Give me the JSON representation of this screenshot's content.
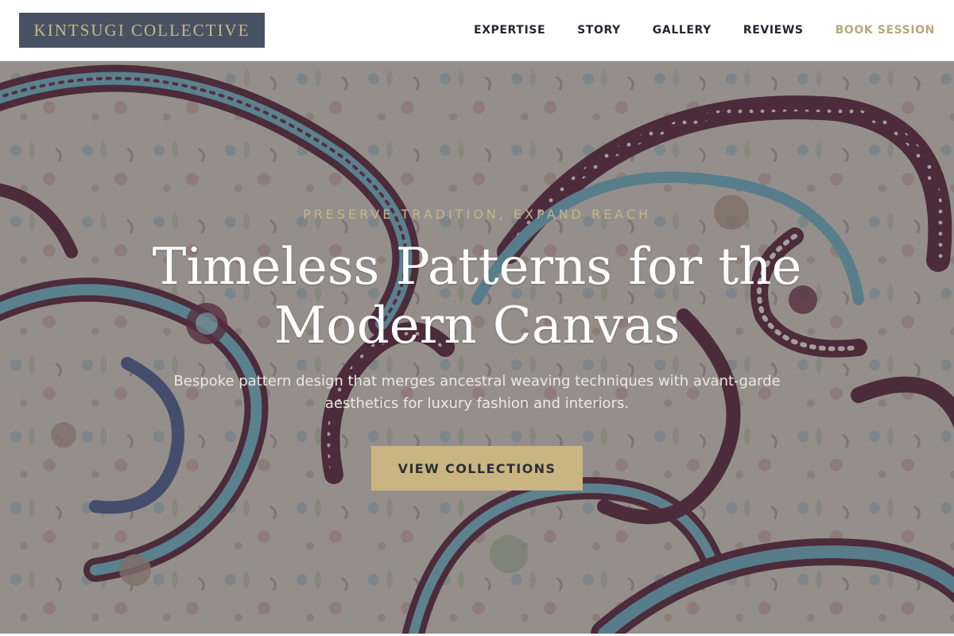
{
  "header": {
    "logo": "KINTSUGI COLLECTIVE",
    "nav": [
      {
        "label": "EXPERTISE"
      },
      {
        "label": "STORY"
      },
      {
        "label": "GALLERY"
      },
      {
        "label": "REVIEWS"
      },
      {
        "label": "BOOK SESSION"
      }
    ]
  },
  "hero": {
    "eyebrow": "PRESERVE TRADITION, EXPAND REACH",
    "headline_line1": "Timeless Patterns for the",
    "headline_line2": "Modern Canvas",
    "subtitle_line1": "Bespoke pattern design that merges ancestral weaving techniques with avant-garde",
    "subtitle_line2": "aesthetics for luxury fashion and interiors.",
    "cta_label": "VIEW COLLECTIONS",
    "background_image": "paisley-fabric-pattern"
  },
  "colors": {
    "logo_bg": "#495262",
    "accent_gold": "#c9b581",
    "nav_text": "#222831"
  }
}
